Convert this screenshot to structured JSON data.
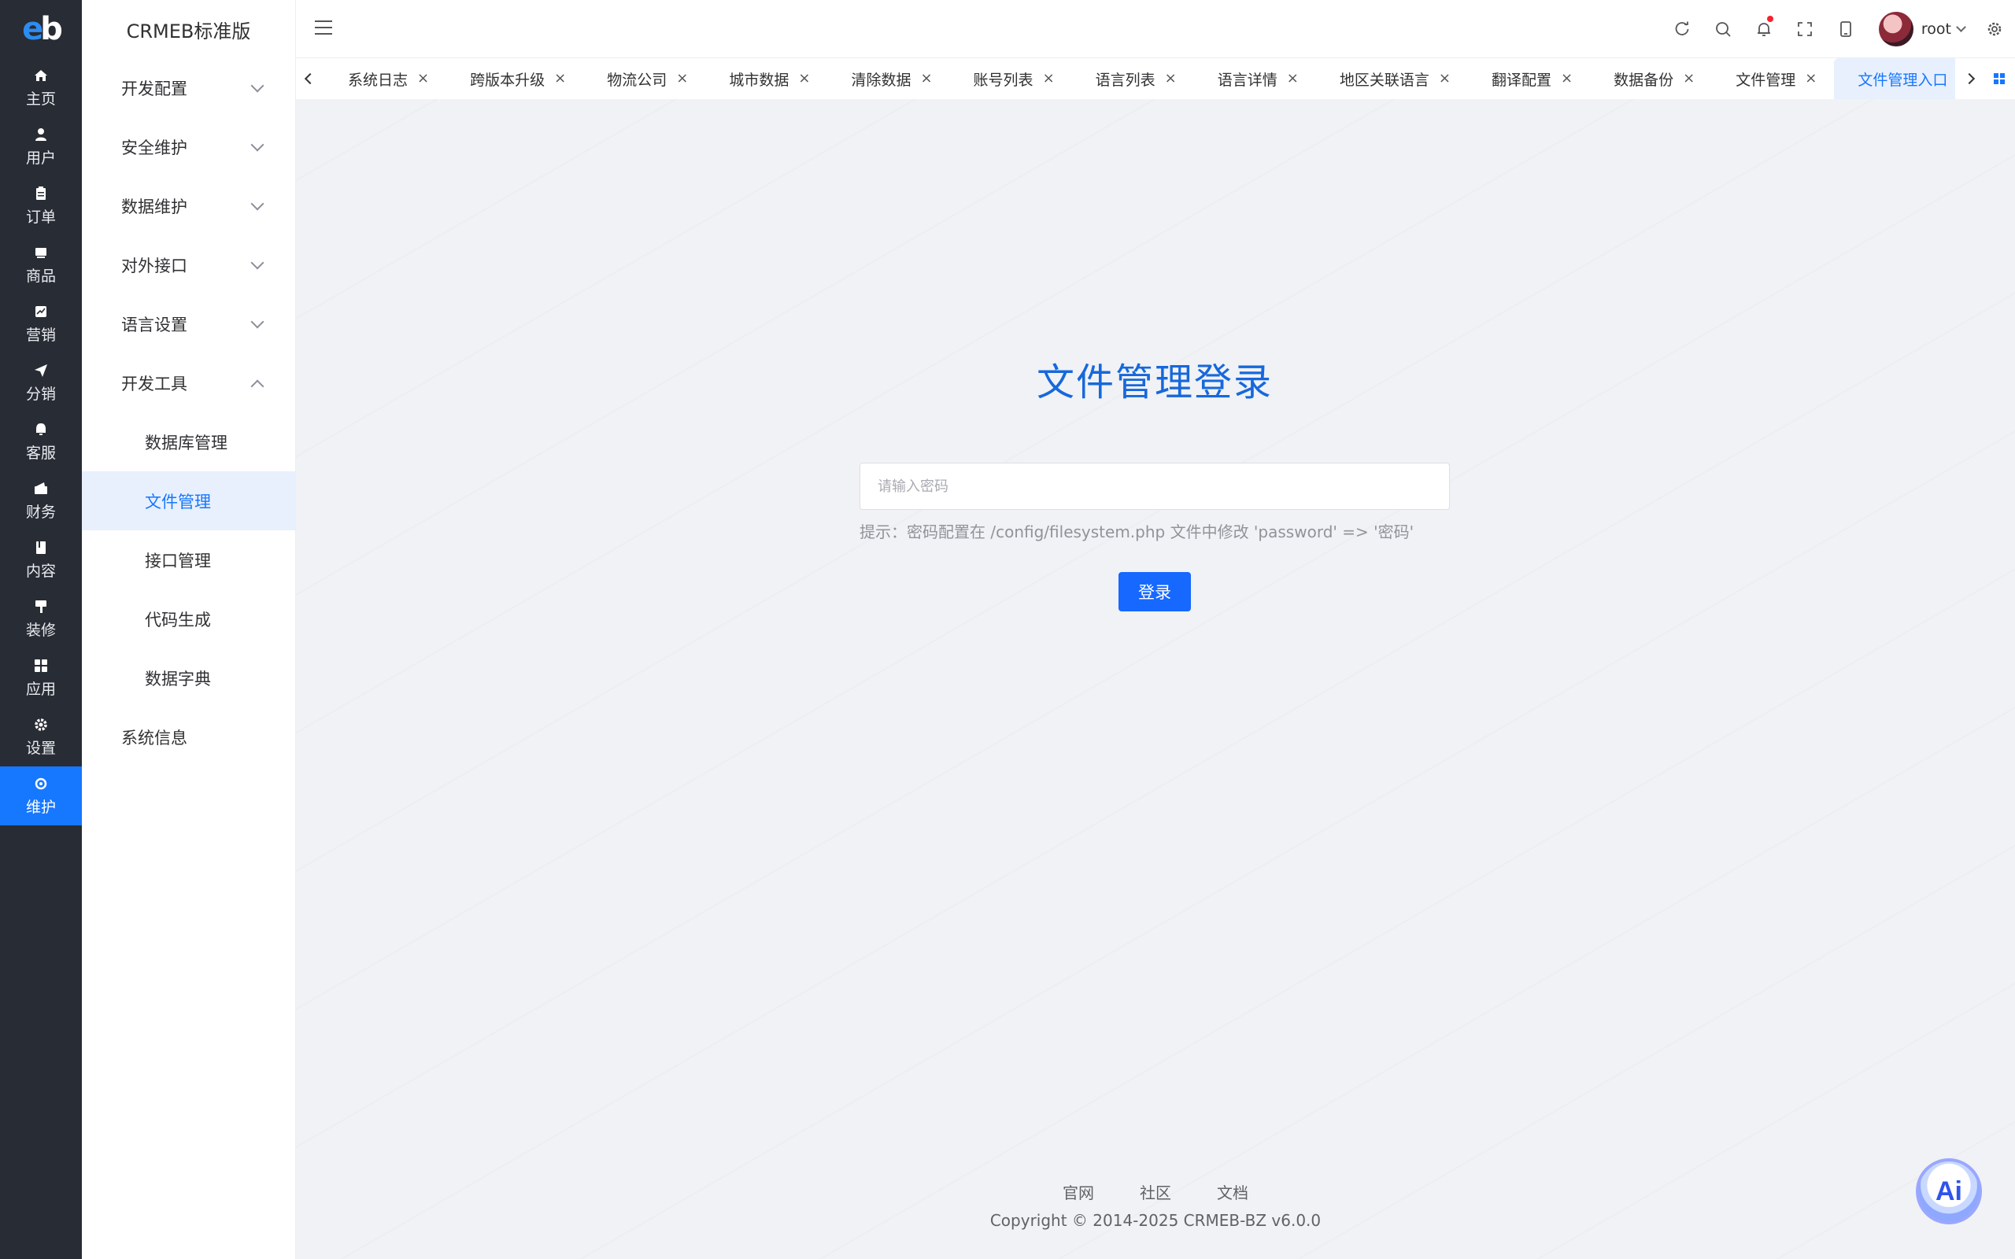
{
  "rail": {
    "logo_left": "e",
    "logo_right": "b",
    "items": [
      {
        "label": "主页",
        "icon": "home-icon"
      },
      {
        "label": "用户",
        "icon": "user-icon"
      },
      {
        "label": "订单",
        "icon": "order-icon"
      },
      {
        "label": "商品",
        "icon": "product-icon"
      },
      {
        "label": "营销",
        "icon": "marketing-icon"
      },
      {
        "label": "分销",
        "icon": "distribution-icon"
      },
      {
        "label": "客服",
        "icon": "customer-service-icon"
      },
      {
        "label": "财务",
        "icon": "finance-icon"
      },
      {
        "label": "内容",
        "icon": "content-icon"
      },
      {
        "label": "装修",
        "icon": "decoration-icon"
      },
      {
        "label": "应用",
        "icon": "apps-icon"
      },
      {
        "label": "设置",
        "icon": "settings-icon"
      },
      {
        "label": "维护",
        "icon": "maintenance-icon",
        "active": true
      }
    ]
  },
  "submenu": {
    "title": "CRMEB标准版",
    "items": [
      {
        "label": "开发配置"
      },
      {
        "label": "安全维护"
      },
      {
        "label": "数据维护"
      },
      {
        "label": "对外接口"
      },
      {
        "label": "语言设置"
      },
      {
        "label": "开发工具"
      },
      {
        "label": "数据库管理"
      },
      {
        "label": "文件管理"
      },
      {
        "label": "接口管理"
      },
      {
        "label": "代码生成"
      },
      {
        "label": "数据字典"
      },
      {
        "label": "系统信息"
      }
    ]
  },
  "header": {
    "user_name": "root"
  },
  "tabs": [
    {
      "label": "系统日志"
    },
    {
      "label": "跨版本升级"
    },
    {
      "label": "物流公司"
    },
    {
      "label": "城市数据"
    },
    {
      "label": "清除数据"
    },
    {
      "label": "账号列表"
    },
    {
      "label": "语言列表"
    },
    {
      "label": "语言详情"
    },
    {
      "label": "地区关联语言"
    },
    {
      "label": "翻译配置"
    },
    {
      "label": "数据备份"
    },
    {
      "label": "文件管理"
    },
    {
      "label": "文件管理入口",
      "active": true
    }
  ],
  "login": {
    "title": "文件管理登录",
    "placeholder": "请输入密码",
    "hint": "提示：密码配置在 /config/filesystem.php 文件中修改 'password' => '密码'",
    "button": "登录"
  },
  "footer": {
    "links": [
      "官网",
      "社区",
      "文档"
    ],
    "copyright": "Copyright © 2014-2025 CRMEB-BZ v6.0.0"
  },
  "ai_button": "Ai",
  "colors": {
    "rail_bg": "#282c34",
    "accent": "#1677ff",
    "active_bg": "#e8f0fe",
    "page_bg": "#f0f2f5"
  }
}
